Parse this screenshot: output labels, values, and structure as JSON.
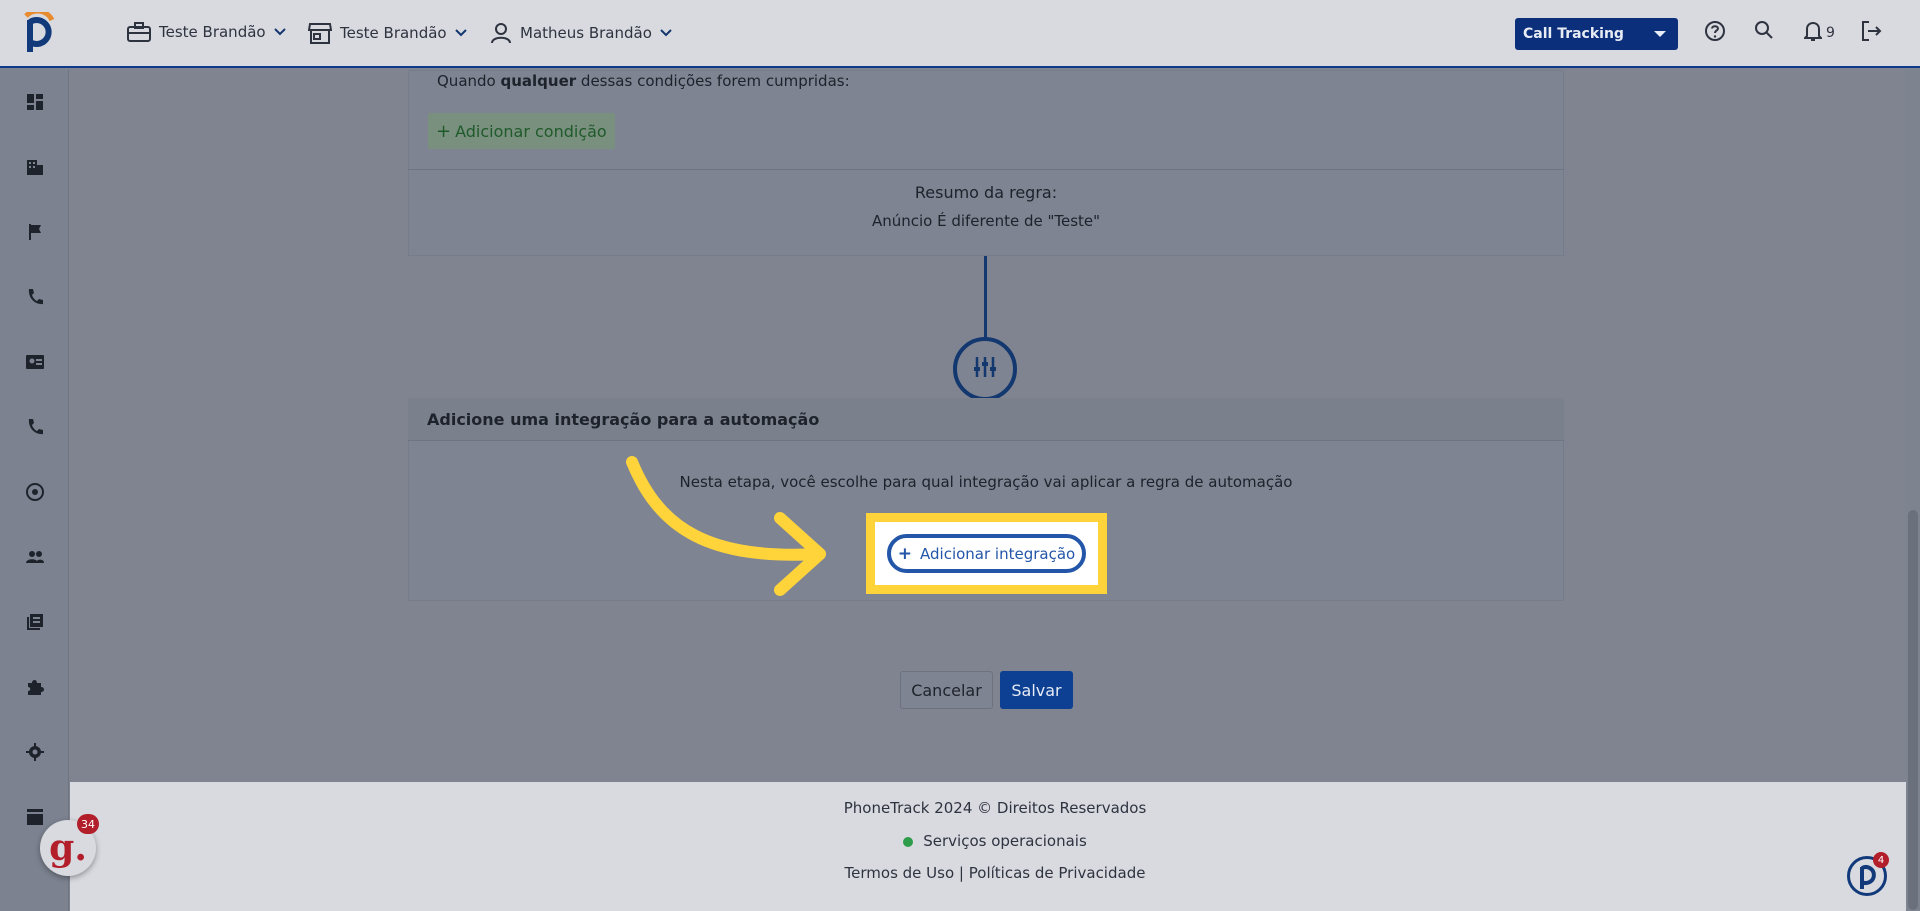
{
  "header": {
    "company_selector": "Teste Brandão",
    "store_selector": "Teste Brandão",
    "user_selector": "Matheus Brandão",
    "product_dropdown": "Call Tracking",
    "notification_count": "9"
  },
  "rule": {
    "condition_text_prefix": "Quando ",
    "condition_text_bold": "qualquer",
    "condition_text_suffix": " dessas condições forem cumpridas:",
    "add_condition_label": "Adicionar condição",
    "summary_title": "Resumo da regra:",
    "summary_text": "Anúncio É diferente de \"Teste\""
  },
  "integration": {
    "title": "Adicione uma integração para a automação",
    "description": "Nesta etapa, você escolhe para qual integração vai aplicar a regra de automação",
    "add_button_label": "Adicionar integração"
  },
  "actions": {
    "cancel_label": "Cancelar",
    "save_label": "Salvar"
  },
  "footer": {
    "copyright": "PhoneTrack 2024 © Direitos Reservados",
    "status": "Serviços operacionais",
    "terms": "Termos de Uso",
    "separator": "|",
    "privacy": "Políticas de Privacidade"
  },
  "widgets": {
    "g_badge": "34",
    "p_badge": "4"
  },
  "colors": {
    "brand_blue": "#0d3f93",
    "highlight_yellow": "#ffd43b",
    "status_green": "#2e9d4b",
    "badge_red": "#b21e2a"
  }
}
